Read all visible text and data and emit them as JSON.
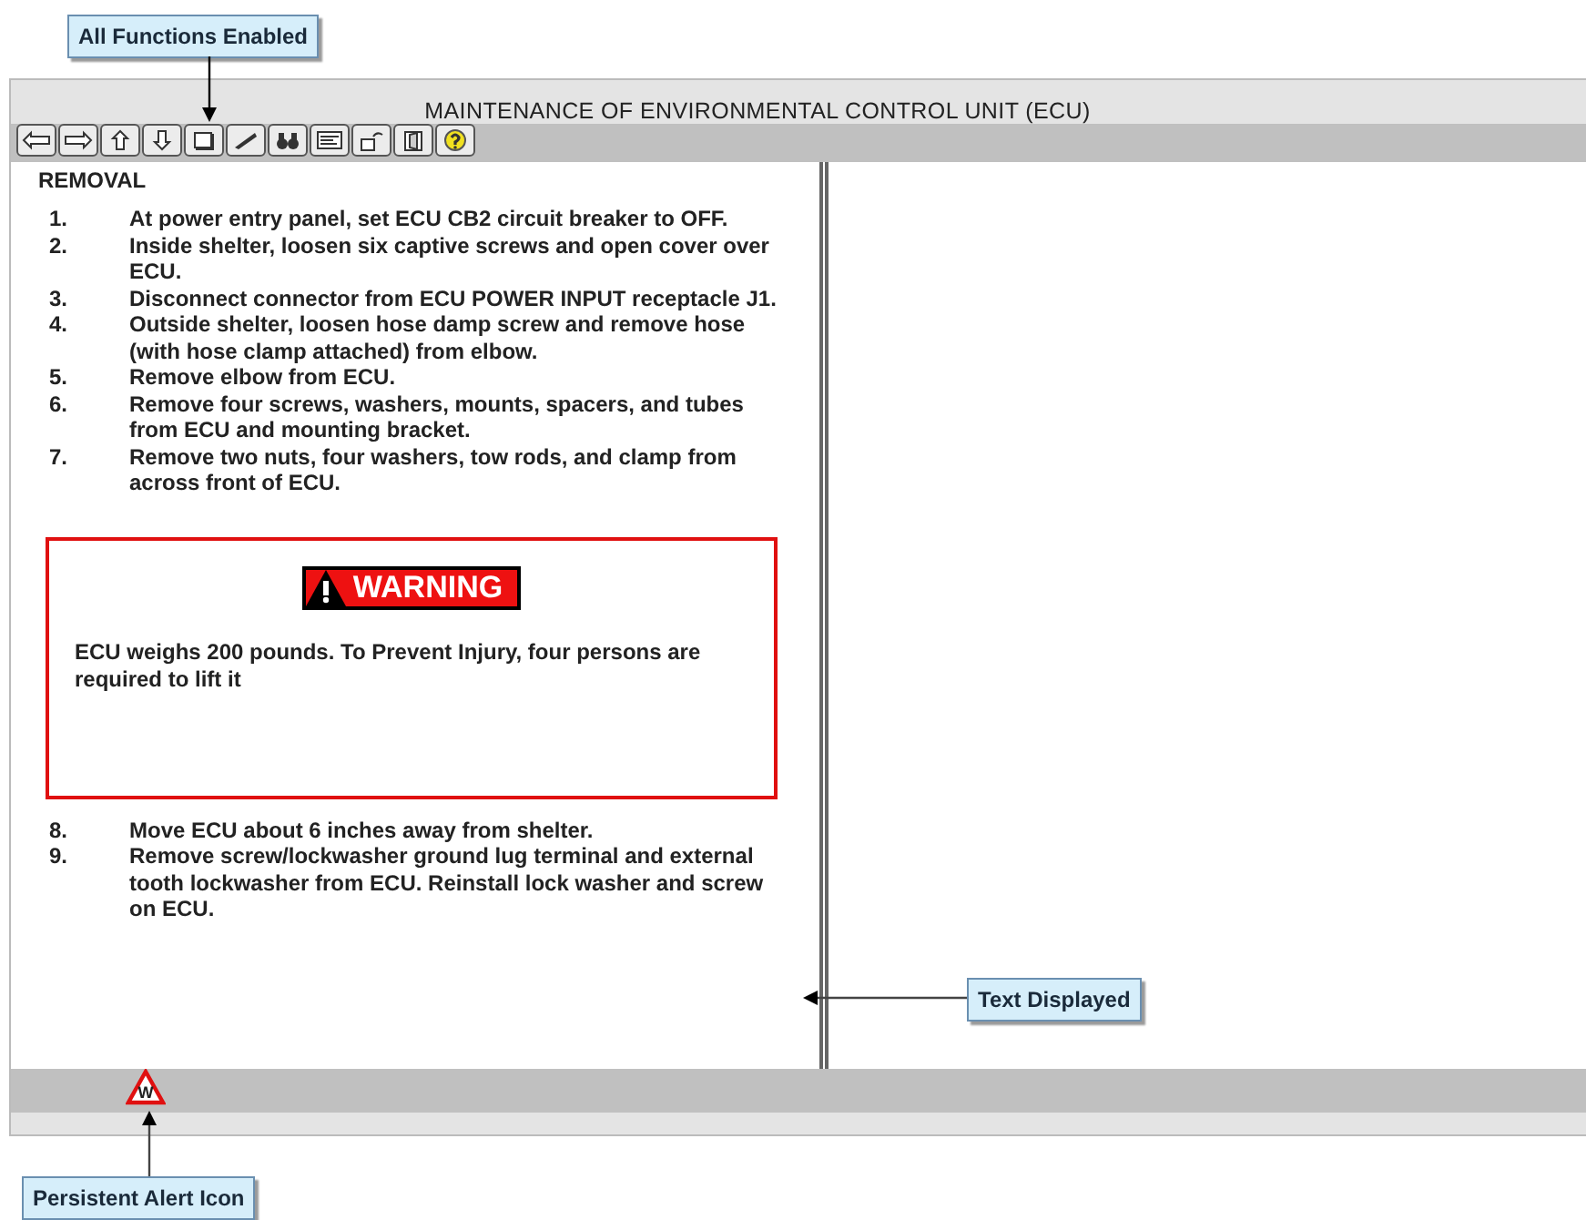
{
  "callouts": [
    {
      "kind": "top",
      "text": "All Functions Enabled"
    },
    {
      "kind": "right",
      "text": "Text Displayed"
    },
    {
      "kind": "bottom",
      "text": "Persistent Alert Icon"
    }
  ],
  "window": {
    "title": "MAINTENANCE OF ENVIRONMENTAL CONTROL UNIT (ECU)"
  },
  "toolbar": {
    "buttons": [
      {
        "kind": "back"
      },
      {
        "kind": "forward"
      },
      {
        "kind": "up"
      },
      {
        "kind": "down"
      },
      {
        "kind": "page"
      },
      {
        "kind": "pen"
      },
      {
        "kind": "search"
      },
      {
        "kind": "card"
      },
      {
        "kind": "key"
      },
      {
        "kind": "exit"
      },
      {
        "kind": "help"
      }
    ]
  },
  "content": {
    "heading": "REMOVAL",
    "steps": [
      {
        "number": "1.",
        "text": "At power entry panel, set ECU CB2 circuit breaker to OFF."
      },
      {
        "number": "2.",
        "text": "Inside shelter, loosen six captive screws and open cover over ECU."
      },
      {
        "number": "3.",
        "text": "Disconnect connector from ECU POWER INPUT receptacle J1."
      },
      {
        "number": "4.",
        "text": "Outside shelter, loosen hose damp screw and remove hose (with hose clamp attached) from elbow."
      },
      {
        "number": "5.",
        "text": "Remove elbow from ECU."
      },
      {
        "number": "6.",
        "text": "Remove four screws, washers, mounts, spacers, and tubes from ECU and mounting bracket."
      },
      {
        "number": "7.",
        "text": "Remove two nuts, four washers, tow rods, and clamp from across front of ECU."
      }
    ],
    "warning": {
      "label": "WARNING",
      "text": "ECU weighs 200 pounds. To Prevent Injury, four persons are required to lift it"
    },
    "steps_after": [
      {
        "number": "8.",
        "text": "Move ECU about 6 inches away from shelter."
      },
      {
        "number": "9.",
        "text": "Remove screw/lockwasher ground lug terminal and external tooth lockwasher from ECU. Reinstall lock washer and screw on ECU."
      }
    ]
  },
  "status_bar": {
    "alert_icon": {
      "letter": "W"
    }
  }
}
